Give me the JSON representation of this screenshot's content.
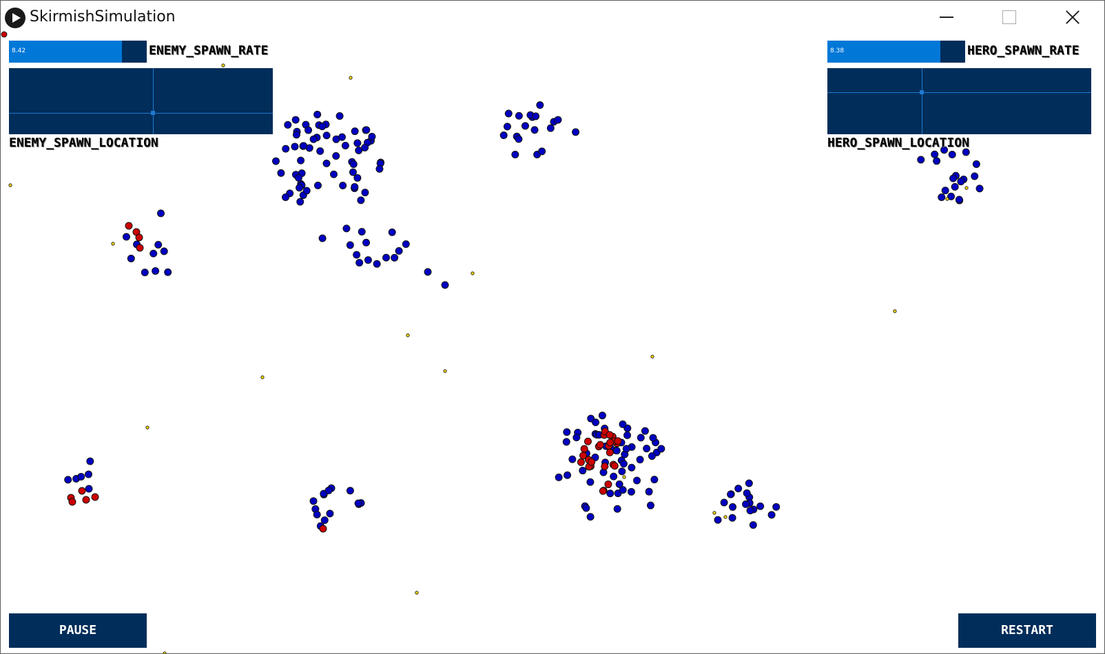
{
  "window": {
    "title": "SkirmishSimulation"
  },
  "controls": {
    "enemy_spawn_rate": {
      "label": "ENEMY_SPAWN_RATE",
      "value": "8.42",
      "fraction": 0.82
    },
    "hero_spawn_rate": {
      "label": "HERO_SPAWN_RATE",
      "value": "8.38",
      "fraction": 0.82
    },
    "enemy_spawn_location": {
      "label": "ENEMY_SPAWN_LOCATION",
      "handle": [
        0.546,
        0.68
      ]
    },
    "hero_spawn_location": {
      "label": "HERO_SPAWN_LOCATION",
      "handle": [
        0.357,
        0.36
      ]
    },
    "pause_label": "PAUSE",
    "restart_label": "RESTART"
  },
  "colors": {
    "hero": "#0000c0",
    "enemy": "#cc0000",
    "food": "#f2d600",
    "panel": "#002d5a",
    "accent": "#0078d7"
  }
}
